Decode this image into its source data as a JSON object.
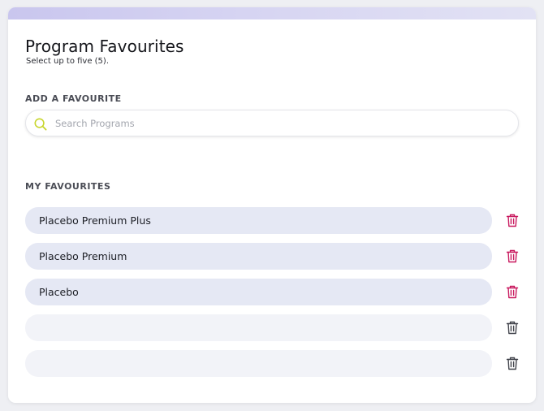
{
  "header": {
    "title": "Program Favourites",
    "subtitle": "Select up to five (5)."
  },
  "add_section": {
    "label": "ADD A FAVOURITE",
    "search_placeholder": "Search Programs",
    "search_value": "",
    "search_icon": "search-icon"
  },
  "favourites_section": {
    "label": "MY FAVOURITES",
    "items": [
      {
        "label": "Placebo Premium Plus",
        "filled": true
      },
      {
        "label": "Placebo Premium",
        "filled": true
      },
      {
        "label": "Placebo",
        "filled": true
      },
      {
        "label": "",
        "filled": false
      },
      {
        "label": "",
        "filled": false
      }
    ],
    "delete_icon": "trash-icon"
  },
  "colors": {
    "accent_bar": "#cfcdf0",
    "pill_filled": "#e5e8f4",
    "pill_empty": "#f2f3f8",
    "trash_active": "#c8175d",
    "trash_inactive": "#3f4149",
    "search_icon": "#c8d62e"
  }
}
